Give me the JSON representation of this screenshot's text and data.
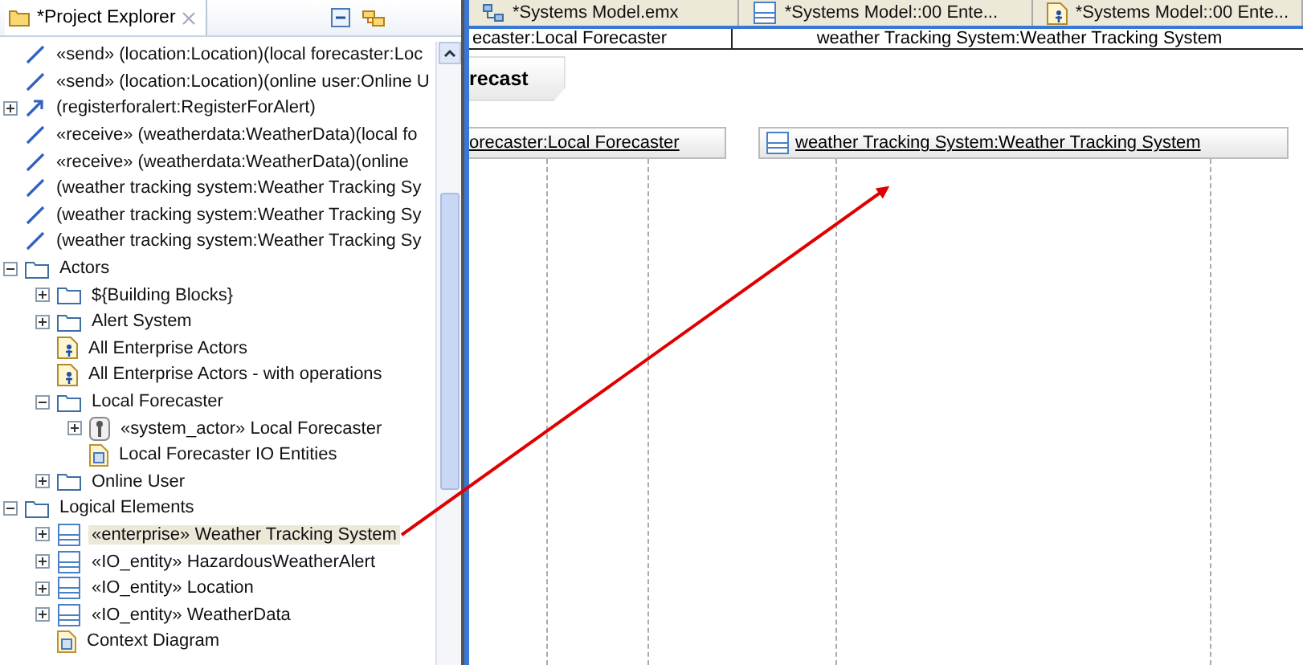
{
  "explorer": {
    "title": "*Project Explorer",
    "tree": [
      {
        "label": "«send» (location:Location)(local forecaster:Loc",
        "kind": "relation",
        "selected": false
      },
      {
        "label": "«send» (location:Location)(online user:Online U",
        "kind": "relation",
        "selected": false
      },
      {
        "label": "(registerforalert:RegisterForAlert)",
        "kind": "relation-arrow",
        "selected": false,
        "expanded": false
      },
      {
        "label": "«receive» (weatherdata:WeatherData)(local fo",
        "kind": "relation",
        "selected": false
      },
      {
        "label": "«receive» (weatherdata:WeatherData)(online",
        "kind": "relation",
        "selected": false
      },
      {
        "label": "(weather tracking system:Weather Tracking Sy",
        "kind": "relation",
        "selected": false
      },
      {
        "label": "(weather tracking system:Weather Tracking Sy",
        "kind": "relation",
        "selected": false
      },
      {
        "label": "(weather tracking system:Weather Tracking Sy",
        "kind": "relation",
        "selected": false
      },
      {
        "label": "Actors",
        "kind": "folder",
        "selected": false,
        "expanded": true,
        "children": [
          {
            "label": "${Building Blocks}",
            "kind": "folder",
            "selected": false,
            "expanded": false
          },
          {
            "label": "Alert System",
            "kind": "folder",
            "selected": false,
            "expanded": false
          },
          {
            "label": "All Enterprise Actors",
            "kind": "actor-diagram",
            "selected": false
          },
          {
            "label": "All Enterprise Actors - with operations",
            "kind": "actor-diagram",
            "selected": false
          },
          {
            "label": "Local Forecaster",
            "kind": "folder",
            "selected": false,
            "expanded": true,
            "children": [
              {
                "label": "«system_actor» Local Forecaster",
                "kind": "actor",
                "selected": false,
                "expanded": false
              },
              {
                "label": "Local Forecaster IO Entities",
                "kind": "diagram",
                "selected": false
              }
            ]
          },
          {
            "label": "Online User",
            "kind": "folder",
            "selected": false,
            "expanded": false
          }
        ]
      },
      {
        "label": "Logical Elements",
        "kind": "folder",
        "selected": false,
        "expanded": true,
        "children": [
          {
            "label": "«enterprise» Weather Tracking System",
            "kind": "class",
            "selected": true,
            "expanded": false
          },
          {
            "label": "«IO_entity» HazardousWeatherAlert",
            "kind": "class",
            "selected": false,
            "expanded": false
          },
          {
            "label": "«IO_entity» Location",
            "kind": "class",
            "selected": false,
            "expanded": false
          },
          {
            "label": "«IO_entity» WeatherData",
            "kind": "class",
            "selected": false,
            "expanded": false
          },
          {
            "label": "Context Diagram",
            "kind": "diagram",
            "selected": false
          }
        ]
      }
    ]
  },
  "editor": {
    "tabs": [
      {
        "label": "*Systems Model.emx",
        "kind": "model",
        "selected": false
      },
      {
        "label": "*Systems Model::00 Ente...",
        "kind": "class",
        "selected": false
      },
      {
        "label": "*Systems Model::00 Ente...",
        "kind": "actor-diagram",
        "selected": false
      }
    ],
    "header_cells": [
      "ecaster:Local Forecaster",
      "weather Tracking System:Weather Tracking System"
    ],
    "frame_label": "recast",
    "lifelines": [
      {
        "label": "orecaster:Local Forecaster",
        "kind": "part"
      },
      {
        "label": "weather Tracking System:Weather Tracking System",
        "kind": "class"
      }
    ]
  }
}
